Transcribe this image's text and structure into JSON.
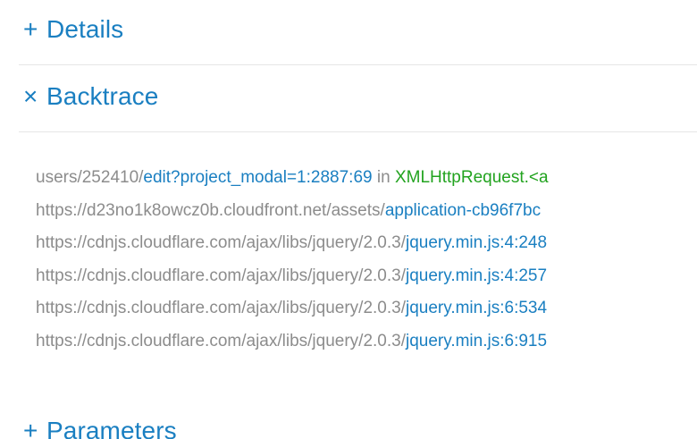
{
  "sections": {
    "details": {
      "toggle": "+",
      "label": "Details"
    },
    "backtrace": {
      "toggle": "×",
      "label": "Backtrace"
    },
    "parameters": {
      "toggle": "+",
      "label": "Parameters"
    }
  },
  "backtrace": {
    "lines": [
      {
        "path": "users/252410/",
        "file": "edit?project_modal=1:2887:69",
        "in": " in ",
        "func": "XMLHttpRequest.<a"
      },
      {
        "path": "https://d23no1k8owcz0b.cloudfront.net/assets/",
        "file": "application-cb96f7bc",
        "in": "",
        "func": ""
      },
      {
        "path": "https://cdnjs.cloudflare.com/ajax/libs/jquery/2.0.3/",
        "file": "jquery.min.js:4:248",
        "in": "",
        "func": ""
      },
      {
        "path": "https://cdnjs.cloudflare.com/ajax/libs/jquery/2.0.3/",
        "file": "jquery.min.js:4:257",
        "in": "",
        "func": ""
      },
      {
        "path": "https://cdnjs.cloudflare.com/ajax/libs/jquery/2.0.3/",
        "file": "jquery.min.js:6:534",
        "in": "",
        "func": ""
      },
      {
        "path": "https://cdnjs.cloudflare.com/ajax/libs/jquery/2.0.3/",
        "file": "jquery.min.js:6:915",
        "in": "",
        "func": ""
      }
    ]
  },
  "colors": {
    "link": "#1a7fc1",
    "path": "#8c8c8c",
    "function": "#22a31f",
    "divider": "#e6e6e6"
  }
}
